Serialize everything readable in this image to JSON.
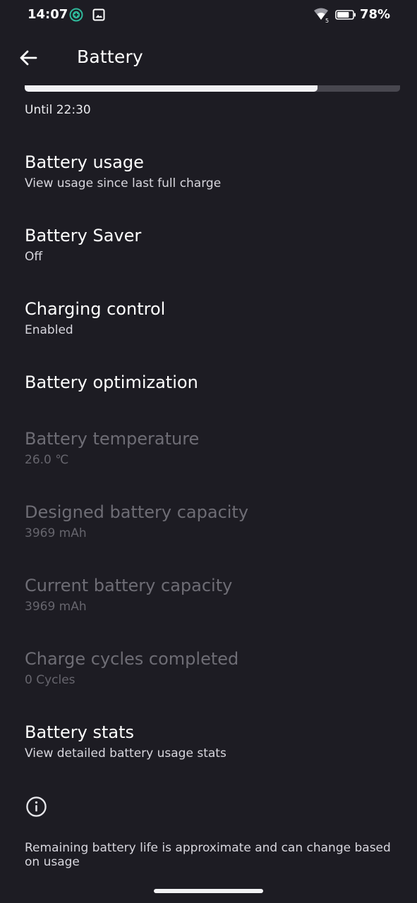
{
  "status_bar": {
    "time": "14:07",
    "battery_percent": "78%",
    "battery_level": 0.78,
    "icons": [
      "vpn-shield-icon",
      "gallery-icon",
      "wifi-icon",
      "battery-icon"
    ]
  },
  "app_bar": {
    "title": "Battery",
    "back_icon": "arrow-back-icon"
  },
  "battery_level_bar": {
    "fill_fraction": 0.78,
    "until_text": "Until 22:30"
  },
  "settings": [
    {
      "title": "Battery usage",
      "summary": "View usage since last full charge",
      "enabled": true
    },
    {
      "title": "Battery Saver",
      "summary": "Off",
      "enabled": true
    },
    {
      "title": "Charging control",
      "summary": "Enabled",
      "enabled": true
    },
    {
      "title": "Battery optimization",
      "summary": "",
      "enabled": true
    },
    {
      "title": "Battery temperature",
      "summary": "26.0 ℃",
      "enabled": false
    },
    {
      "title": "Designed battery capacity",
      "summary": "3969 mAh",
      "enabled": false
    },
    {
      "title": "Current battery capacity",
      "summary": "3969 mAh",
      "enabled": false
    },
    {
      "title": "Charge cycles completed",
      "summary": "0 Cycles",
      "enabled": false
    },
    {
      "title": "Battery stats",
      "summary": "View detailed battery usage stats",
      "enabled": true
    }
  ],
  "footer": {
    "icon": "info-icon",
    "text": "Remaining battery life is approximate and can change based on usage"
  },
  "colors": {
    "background": "#1d1c23",
    "text_primary": "#ffffff",
    "text_disabled": "#6e6d75",
    "bar_fill": "#f1f1f4",
    "bar_track": "#48474f"
  }
}
